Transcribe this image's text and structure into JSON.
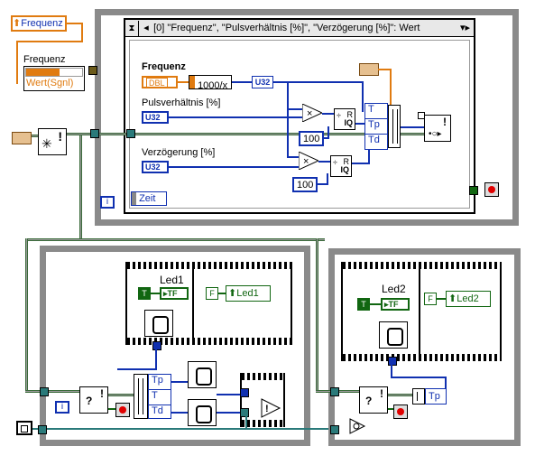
{
  "nodes": {
    "frequenz_local": "Frequenz",
    "frequenz_label_top": "Frequenz",
    "wert_sgnl": "Wert(Sgnl)",
    "case_selector": "[0] \"Frequenz\", \"Pulsverhältnis [%]\", \"Verzögerung [%]\": Wert",
    "frequenz_inner": "Frequenz",
    "dbl": "DBL",
    "formula": "1000/x",
    "u32_out": "U32",
    "puls_label": "Pulsverhältnis [%]",
    "u32_puls": "U32",
    "verz_label": "Verzögerung [%]",
    "u32_verz": "U32",
    "const_100_a": "100",
    "const_100_b": "100",
    "bundle_t": "T",
    "bundle_tp": "Tp",
    "bundle_td": "Td",
    "zeit_label": "Zeit",
    "led1_label": "Led1",
    "led1_tf": "TF",
    "led1_true": "T",
    "led1_false": "F",
    "led1_local": "Led1",
    "unbundle_tp": "Tp",
    "unbundle_t": "T",
    "unbundle_td": "Td",
    "led2_label": "Led2",
    "led2_tf": "TF",
    "led2_true": "T",
    "led2_false": "F",
    "led2_local": "Led2",
    "unbundle2_tp": "Tp",
    "info_i": "i",
    "divide_r": "R",
    "divide_iq": "IQ",
    "err_symbol": "!",
    "question": "?"
  },
  "colors": {
    "loop_gray": "#8a8a8a",
    "orange_wire": "#e07b10",
    "blue_wire": "#1030b0",
    "green_wire": "#116611",
    "stop_red": "#e00000"
  }
}
